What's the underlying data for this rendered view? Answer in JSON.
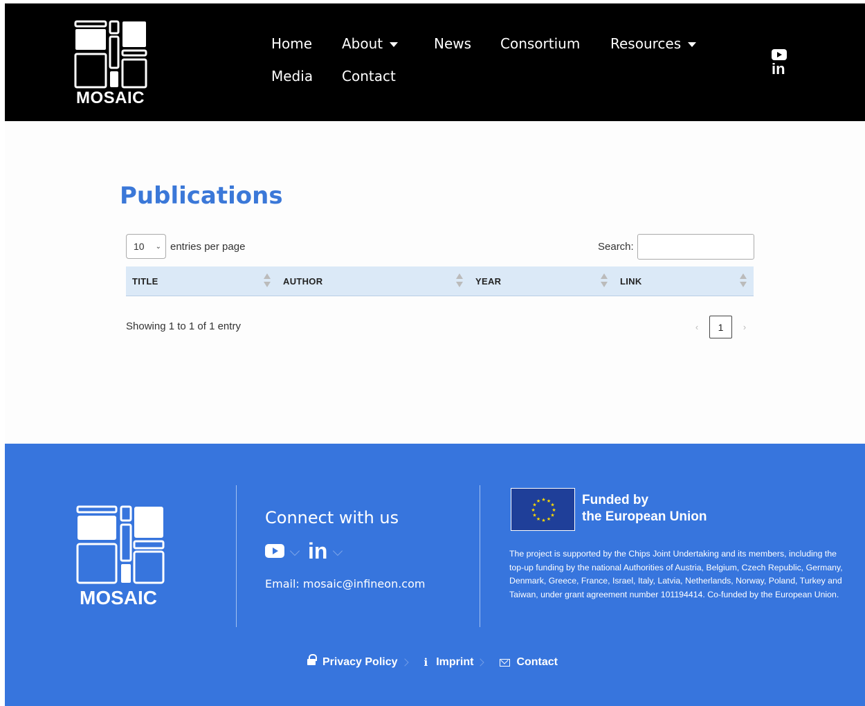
{
  "header": {
    "logo_text": "MOSAIC",
    "nav": [
      {
        "label": "Home",
        "has_dropdown": false
      },
      {
        "label": "About",
        "has_dropdown": true
      },
      {
        "label": "News",
        "has_dropdown": false
      },
      {
        "label": "Consortium",
        "has_dropdown": false
      },
      {
        "label": "Resources",
        "has_dropdown": true
      },
      {
        "label": "Media",
        "has_dropdown": false
      },
      {
        "label": "Contact",
        "has_dropdown": false
      }
    ],
    "social_icons": [
      "youtube-icon",
      "linkedin-icon"
    ],
    "linkedin_glyph": "in"
  },
  "main": {
    "title": "Publications",
    "entries_value": "10",
    "entries_label": "entries per page",
    "search_label": "Search:",
    "search_value": "",
    "columns": [
      "TITLE",
      "AUTHOR",
      "YEAR",
      "LINK"
    ],
    "info": "Showing 1 to 1 of 1 entry",
    "pager": {
      "prev": "‹",
      "current": "1",
      "next": "›"
    }
  },
  "footer": {
    "logo_text": "MOSAIC",
    "connect_title": "Connect with us",
    "linkedin_glyph": "in",
    "email": "Email: mosaic@infineon.com",
    "funded_line1": "Funded by",
    "funded_line2": "the European Union",
    "eu_text": "The project is supported by the Chips Joint Undertaking and its members, including the top-up funding by the national Authorities of Austria, Belgium, Czech Republic, Germany, Denmark, Greece, France, Israel, Italy, Latvia, Netherlands, Norway, Poland, Turkey and Taiwan, under grant agreement number 101194414. Co-funded by the European Union.",
    "links": [
      {
        "label": "Privacy Policy",
        "icon": "lock-icon"
      },
      {
        "label": "Imprint",
        "icon": "info-icon"
      },
      {
        "label": "Contact",
        "icon": "envelope-icon"
      }
    ],
    "info_glyph": "i"
  },
  "colors": {
    "header_bg": "#000000",
    "accent": "#3b78d8",
    "footer_bg": "#3775dd",
    "table_header_bg": "#dbe9f7",
    "eu_flag": "#1f3f99"
  }
}
